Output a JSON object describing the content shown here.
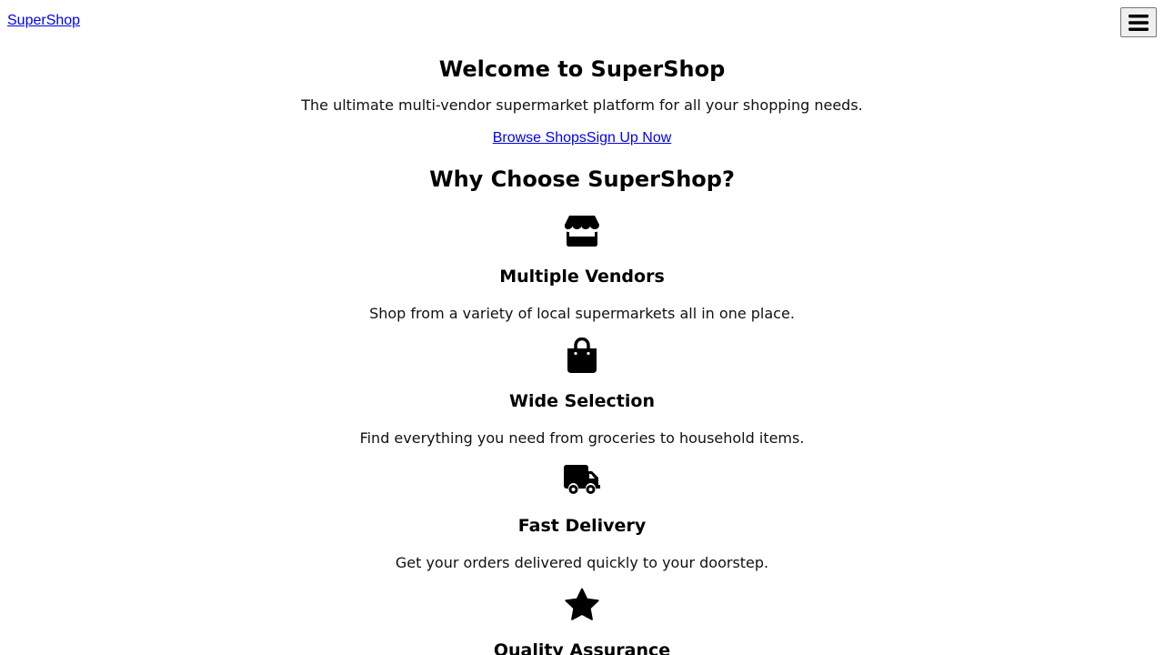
{
  "header": {
    "brand": "SuperShop",
    "menu_icon": "hamburger-icon"
  },
  "hero": {
    "title": "Welcome to SuperShop",
    "subtitle": "The ultimate multi-vendor supermarket platform for all your shopping needs.",
    "browse_label": "Browse Shops",
    "signup_label": "Sign Up Now"
  },
  "features": {
    "title": "Why Choose SuperShop?",
    "items": [
      {
        "icon": "store-icon",
        "title": "Multiple Vendors",
        "description": "Shop from a variety of local supermarkets all in one place."
      },
      {
        "icon": "shopping-bag-icon",
        "title": "Wide Selection",
        "description": "Find everything you need from groceries to household items."
      },
      {
        "icon": "truck-icon",
        "title": "Fast Delivery",
        "description": "Get your orders delivered quickly to your doorstep."
      },
      {
        "icon": "star-icon",
        "title": "Quality Assurance",
        "description": ""
      }
    ]
  }
}
